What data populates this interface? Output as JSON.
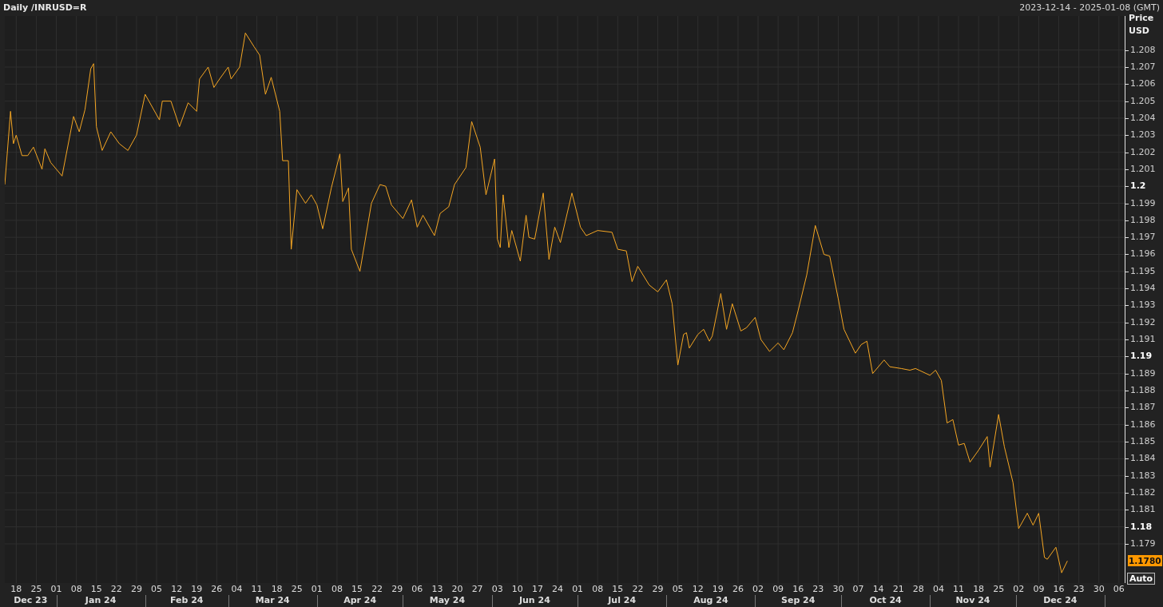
{
  "header": {
    "range": "2023-12-14 - 2025-01-08 (GMT)"
  },
  "axis_header": [
    "Price",
    "USD"
  ],
  "last_price": {
    "label": "1.1780"
  },
  "auto_button": "Auto",
  "months": [
    "Dec 23",
    "Jan 24",
    "Feb 24",
    "Mar 24",
    "Apr 24",
    "May 24",
    "Jun 24",
    "Jul 24",
    "Aug 24",
    "Sep 24",
    "Oct 24",
    "Nov 24",
    "Dec 24"
  ],
  "chart_data": {
    "type": "line",
    "title": "Daily /INRUSD=R",
    "grid": true,
    "xlim": [
      "2023-12-14",
      "2025-01-08"
    ],
    "ylim": [
      1.1767,
      1.21
    ],
    "xticks": [
      {
        "value": "2023-12-18",
        "label": "18"
      },
      {
        "value": "2023-12-25",
        "label": "25"
      },
      {
        "value": "2024-01-01",
        "label": "01"
      },
      {
        "value": "2024-01-08",
        "label": "08"
      },
      {
        "value": "2024-01-15",
        "label": "15"
      },
      {
        "value": "2024-01-22",
        "label": "22"
      },
      {
        "value": "2024-01-29",
        "label": "29"
      },
      {
        "value": "2024-02-05",
        "label": "05"
      },
      {
        "value": "2024-02-12",
        "label": "12"
      },
      {
        "value": "2024-02-19",
        "label": "19"
      },
      {
        "value": "2024-02-26",
        "label": "26"
      },
      {
        "value": "2024-03-04",
        "label": "04"
      },
      {
        "value": "2024-03-11",
        "label": "11"
      },
      {
        "value": "2024-03-18",
        "label": "18"
      },
      {
        "value": "2024-03-25",
        "label": "25"
      },
      {
        "value": "2024-04-01",
        "label": "01"
      },
      {
        "value": "2024-04-08",
        "label": "08"
      },
      {
        "value": "2024-04-15",
        "label": "15"
      },
      {
        "value": "2024-04-22",
        "label": "22"
      },
      {
        "value": "2024-04-29",
        "label": "29"
      },
      {
        "value": "2024-05-06",
        "label": "06"
      },
      {
        "value": "2024-05-13",
        "label": "13"
      },
      {
        "value": "2024-05-20",
        "label": "20"
      },
      {
        "value": "2024-05-27",
        "label": "27"
      },
      {
        "value": "2024-06-03",
        "label": "03"
      },
      {
        "value": "2024-06-10",
        "label": "10"
      },
      {
        "value": "2024-06-17",
        "label": "17"
      },
      {
        "value": "2024-06-24",
        "label": "24"
      },
      {
        "value": "2024-07-01",
        "label": "01"
      },
      {
        "value": "2024-07-08",
        "label": "08"
      },
      {
        "value": "2024-07-15",
        "label": "15"
      },
      {
        "value": "2024-07-22",
        "label": "22"
      },
      {
        "value": "2024-07-29",
        "label": "29"
      },
      {
        "value": "2024-08-05",
        "label": "05"
      },
      {
        "value": "2024-08-12",
        "label": "12"
      },
      {
        "value": "2024-08-19",
        "label": "19"
      },
      {
        "value": "2024-08-26",
        "label": "26"
      },
      {
        "value": "2024-09-02",
        "label": "02"
      },
      {
        "value": "2024-09-09",
        "label": "09"
      },
      {
        "value": "2024-09-16",
        "label": "16"
      },
      {
        "value": "2024-09-23",
        "label": "23"
      },
      {
        "value": "2024-09-30",
        "label": "30"
      },
      {
        "value": "2024-10-07",
        "label": "07"
      },
      {
        "value": "2024-10-14",
        "label": "14"
      },
      {
        "value": "2024-10-21",
        "label": "21"
      },
      {
        "value": "2024-10-28",
        "label": "28"
      },
      {
        "value": "2024-11-04",
        "label": "04"
      },
      {
        "value": "2024-11-11",
        "label": "11"
      },
      {
        "value": "2024-11-18",
        "label": "18"
      },
      {
        "value": "2024-11-25",
        "label": "25"
      },
      {
        "value": "2024-12-02",
        "label": "02"
      },
      {
        "value": "2024-12-09",
        "label": "09"
      },
      {
        "value": "2024-12-16",
        "label": "16"
      },
      {
        "value": "2024-12-23",
        "label": "23"
      },
      {
        "value": "2024-12-30",
        "label": "30"
      },
      {
        "value": "2025-01-06",
        "label": "06"
      }
    ],
    "yticks": [
      1.179,
      1.18,
      1.181,
      1.182,
      1.183,
      1.184,
      1.185,
      1.186,
      1.187,
      1.188,
      1.189,
      1.19,
      1.191,
      1.192,
      1.193,
      1.194,
      1.195,
      1.196,
      1.197,
      1.198,
      1.199,
      1.2,
      1.201,
      1.202,
      1.203,
      1.204,
      1.205,
      1.206,
      1.207,
      1.208
    ],
    "x": [
      "2023-12-14",
      "2023-12-16",
      "2023-12-17",
      "2023-12-18",
      "2023-12-20",
      "2023-12-22",
      "2023-12-24",
      "2023-12-27",
      "2023-12-28",
      "2023-12-30",
      "2024-01-03",
      "2024-01-07",
      "2024-01-09",
      "2024-01-11",
      "2024-01-13",
      "2024-01-14",
      "2024-01-15",
      "2024-01-17",
      "2024-01-20",
      "2024-01-23",
      "2024-01-26",
      "2024-01-29",
      "2024-02-01",
      "2024-02-06",
      "2024-02-07",
      "2024-02-10",
      "2024-02-13",
      "2024-02-16",
      "2024-02-19",
      "2024-02-20",
      "2024-02-23",
      "2024-02-25",
      "2024-02-27",
      "2024-03-01",
      "2024-03-02",
      "2024-03-05",
      "2024-03-07",
      "2024-03-10",
      "2024-03-12",
      "2024-03-14",
      "2024-03-16",
      "2024-03-19",
      "2024-03-20",
      "2024-03-22",
      "2024-03-23",
      "2024-03-25",
      "2024-03-28",
      "2024-03-30",
      "2024-04-01",
      "2024-04-03",
      "2024-04-06",
      "2024-04-09",
      "2024-04-10",
      "2024-04-12",
      "2024-04-13",
      "2024-04-16",
      "2024-04-20",
      "2024-04-23",
      "2024-04-25",
      "2024-04-27",
      "2024-05-01",
      "2024-05-04",
      "2024-05-06",
      "2024-05-08",
      "2024-05-12",
      "2024-05-14",
      "2024-05-17",
      "2024-05-19",
      "2024-05-23",
      "2024-05-25",
      "2024-05-28",
      "2024-05-30",
      "2024-06-02",
      "2024-06-03",
      "2024-06-04",
      "2024-06-05",
      "2024-06-07",
      "2024-06-08",
      "2024-06-11",
      "2024-06-13",
      "2024-06-14",
      "2024-06-16",
      "2024-06-19",
      "2024-06-21",
      "2024-06-23",
      "2024-06-25",
      "2024-06-29",
      "2024-07-02",
      "2024-07-04",
      "2024-07-08",
      "2024-07-13",
      "2024-07-15",
      "2024-07-18",
      "2024-07-20",
      "2024-07-22",
      "2024-07-26",
      "2024-07-29",
      "2024-08-01",
      "2024-08-03",
      "2024-08-05",
      "2024-08-07",
      "2024-08-08",
      "2024-08-09",
      "2024-08-12",
      "2024-08-14",
      "2024-08-16",
      "2024-08-17",
      "2024-08-20",
      "2024-08-22",
      "2024-08-24",
      "2024-08-27",
      "2024-08-29",
      "2024-09-01",
      "2024-09-03",
      "2024-09-06",
      "2024-09-09",
      "2024-09-11",
      "2024-09-14",
      "2024-09-16",
      "2024-09-19",
      "2024-09-22",
      "2024-09-25",
      "2024-09-27",
      "2024-09-30",
      "2024-10-02",
      "2024-10-06",
      "2024-10-08",
      "2024-10-10",
      "2024-10-12",
      "2024-10-16",
      "2024-10-18",
      "2024-10-22",
      "2024-10-25",
      "2024-10-27",
      "2024-11-01",
      "2024-11-03",
      "2024-11-05",
      "2024-11-07",
      "2024-11-09",
      "2024-11-11",
      "2024-11-13",
      "2024-11-15",
      "2024-11-18",
      "2024-11-21",
      "2024-11-22",
      "2024-11-25",
      "2024-11-27",
      "2024-11-30",
      "2024-12-02",
      "2024-12-05",
      "2024-12-07",
      "2024-12-09",
      "2024-12-11",
      "2024-12-12",
      "2024-12-15",
      "2024-12-17",
      "2024-12-19"
    ],
    "series": [
      {
        "color": "#f5a623",
        "values": [
          1.2001,
          1.2044,
          1.2025,
          1.203,
          1.2018,
          1.2018,
          1.2023,
          1.201,
          1.2022,
          1.2014,
          1.2006,
          1.2041,
          1.2032,
          1.2045,
          1.2069,
          1.2072,
          1.2035,
          1.2021,
          1.2032,
          1.2025,
          1.2021,
          1.203,
          1.2054,
          1.2039,
          1.205,
          1.205,
          1.2035,
          1.2049,
          1.2044,
          1.2063,
          1.207,
          1.2058,
          1.2063,
          1.207,
          1.2063,
          1.207,
          1.209,
          1.2082,
          1.2077,
          1.2054,
          1.2064,
          1.2044,
          1.2015,
          1.2015,
          1.1963,
          1.1998,
          1.199,
          1.1995,
          1.1989,
          1.1975,
          1.1999,
          1.2019,
          1.1991,
          1.1999,
          1.1963,
          1.195,
          1.199,
          1.2001,
          1.2,
          1.1989,
          1.1981,
          1.1992,
          1.1976,
          1.1983,
          1.1971,
          1.1984,
          1.1988,
          1.2001,
          1.2011,
          1.2038,
          1.2023,
          1.1995,
          1.2016,
          1.1969,
          1.1964,
          1.1995,
          1.1964,
          1.1974,
          1.1956,
          1.1983,
          1.197,
          1.1969,
          1.1996,
          1.1957,
          1.1976,
          1.1967,
          1.1996,
          1.1976,
          1.1971,
          1.1974,
          1.1973,
          1.1963,
          1.1962,
          1.1944,
          1.1953,
          1.1942,
          1.1938,
          1.1945,
          1.1931,
          1.1895,
          1.1913,
          1.1914,
          1.1905,
          1.1913,
          1.1916,
          1.1909,
          1.1912,
          1.1937,
          1.1916,
          1.1931,
          1.1915,
          1.1917,
          1.1923,
          1.191,
          1.1903,
          1.1908,
          1.1904,
          1.1914,
          1.1927,
          1.1948,
          1.1977,
          1.196,
          1.1959,
          1.1934,
          1.1916,
          1.1902,
          1.1907,
          1.1909,
          1.189,
          1.1898,
          1.1894,
          1.1893,
          1.1892,
          1.1893,
          1.1889,
          1.1892,
          1.1886,
          1.1861,
          1.1863,
          1.1848,
          1.1849,
          1.1838,
          1.1845,
          1.1853,
          1.1835,
          1.1866,
          1.1847,
          1.1826,
          1.1799,
          1.1808,
          1.1801,
          1.1808,
          1.1782,
          1.1781,
          1.1788,
          1.1773,
          1.178
        ]
      }
    ]
  }
}
